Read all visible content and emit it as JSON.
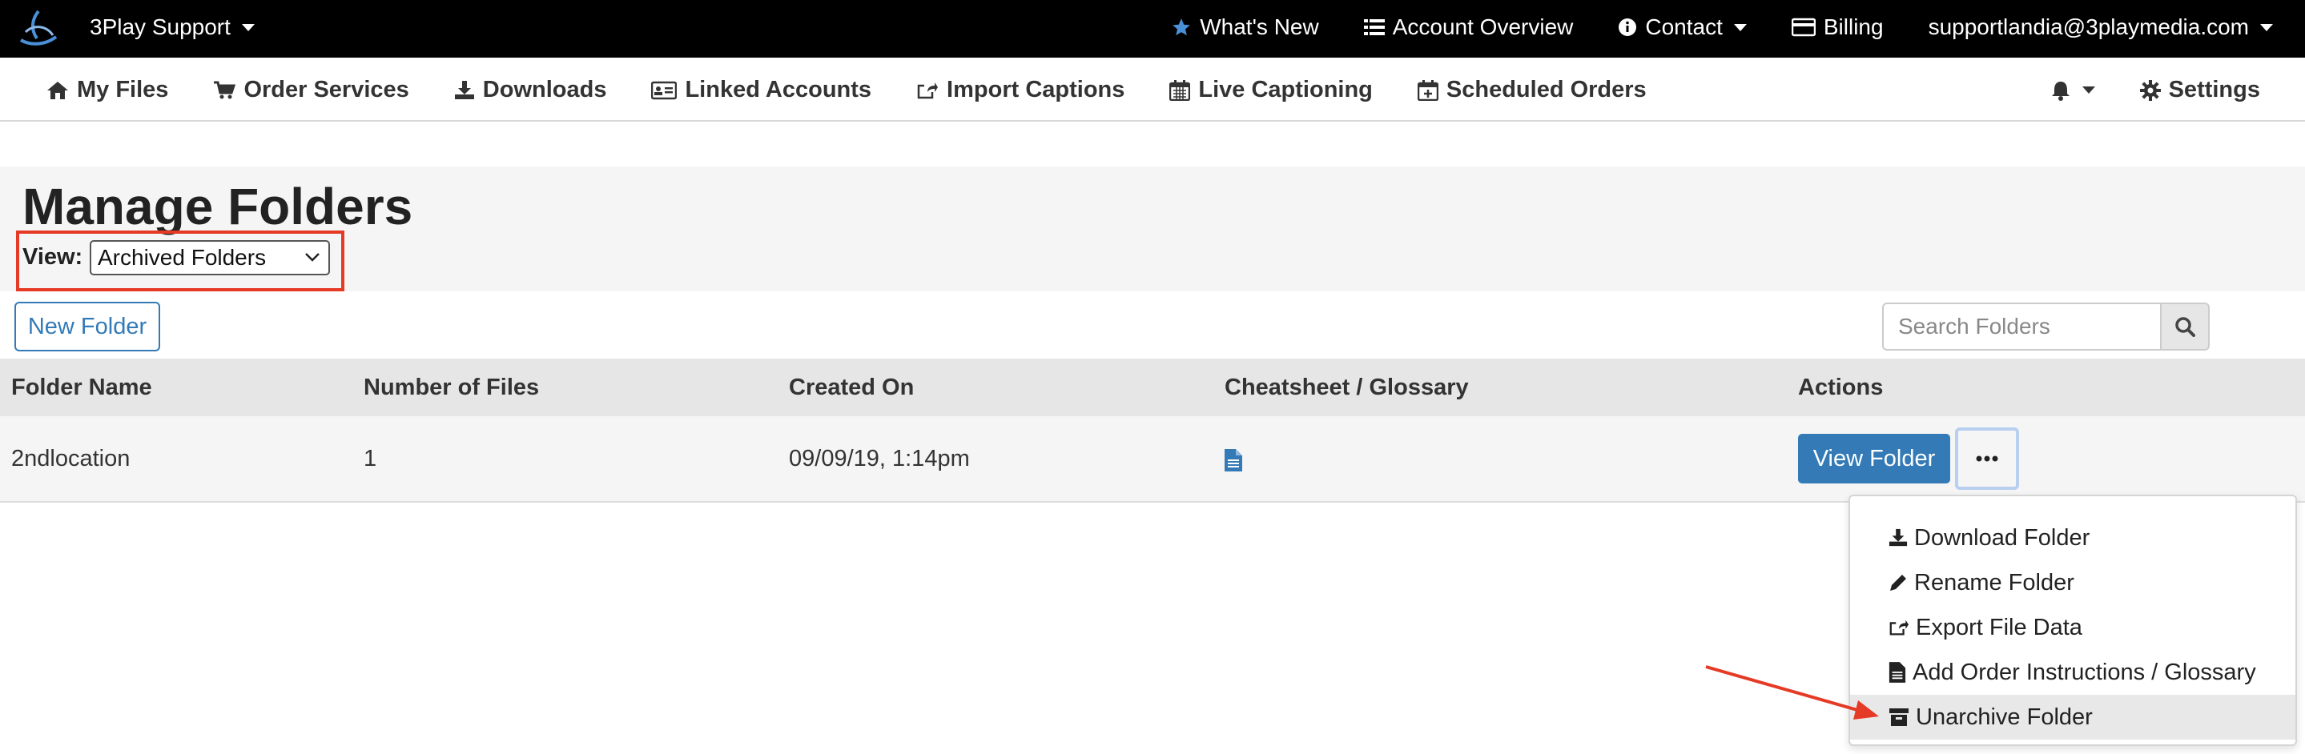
{
  "topbar": {
    "brand": "3Play Support",
    "items": [
      {
        "label": "What's New",
        "icon": "star-icon"
      },
      {
        "label": "Account Overview",
        "icon": "list-icon"
      },
      {
        "label": "Contact",
        "icon": "info-circle-icon"
      },
      {
        "label": "Billing",
        "icon": "credit-card-icon"
      },
      {
        "label": "supportlandia@3playmedia.com",
        "icon": ""
      }
    ]
  },
  "subnav": {
    "items": [
      {
        "label": "My Files",
        "icon": "home-icon"
      },
      {
        "label": "Order Services",
        "icon": "cart-icon"
      },
      {
        "label": "Downloads",
        "icon": "download-icon"
      },
      {
        "label": "Linked Accounts",
        "icon": "id-card-icon"
      },
      {
        "label": "Import Captions",
        "icon": "share-square-icon"
      },
      {
        "label": "Live Captioning",
        "icon": "calendar-icon"
      },
      {
        "label": "Scheduled Orders",
        "icon": "calendar-plus-icon"
      }
    ],
    "settings": "Settings"
  },
  "page": {
    "title": "Manage Folders",
    "view_label": "View:",
    "view_value": "Archived Folders",
    "new_folder": "New Folder",
    "search_placeholder": "Search Folders"
  },
  "table": {
    "headers": [
      "Folder Name",
      "Number of Files",
      "Created On",
      "Cheatsheet / Glossary",
      "Actions"
    ],
    "rows": [
      {
        "name": "2ndlocation",
        "files": "1",
        "created": "09/09/19, 1:14pm",
        "view_button": "View Folder"
      }
    ]
  },
  "menu": {
    "items": [
      {
        "label": "Download Folder",
        "icon": "download-icon"
      },
      {
        "label": "Rename Folder",
        "icon": "pencil-icon"
      },
      {
        "label": "Export File Data",
        "icon": "share-square-icon"
      },
      {
        "label": "Add Order Instructions / Glossary",
        "icon": "file-text-icon"
      },
      {
        "label": "Unarchive Folder",
        "icon": "archive-icon"
      }
    ],
    "active_index": 4
  },
  "colors": {
    "primary": "#337ab7",
    "highlight_box": "#e53a25",
    "topbar": "#000000"
  }
}
